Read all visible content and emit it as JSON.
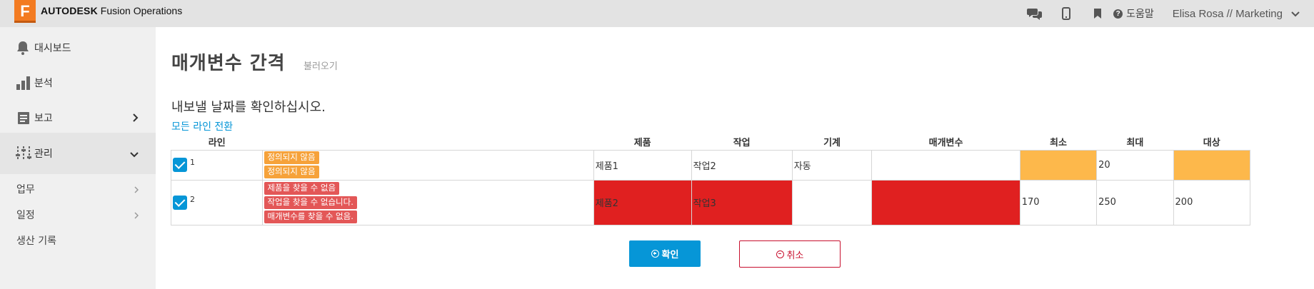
{
  "app": {
    "logo_letter": "F",
    "brand_bold": "AUTODESK",
    "brand_rest": "Fusion Operations"
  },
  "topbar": {
    "icons": [
      "chat-icon",
      "mobile-icon",
      "bookmark-icon"
    ],
    "help_label": "도움말",
    "help_icon_glyph": "?",
    "user_label": "Elisa Rosa // Marketing"
  },
  "sidebar": {
    "items": [
      {
        "label": "대시보드",
        "icon": "bell-icon"
      },
      {
        "label": "분석",
        "icon": "bar-chart-icon"
      },
      {
        "label": "보고",
        "icon": "report-icon"
      },
      {
        "label": "관리",
        "icon": "sliders-icon"
      }
    ],
    "subitems": [
      {
        "label": "업무"
      },
      {
        "label": "일정"
      },
      {
        "label": "생산 기록"
      }
    ]
  },
  "main": {
    "title": "매개변수 간격",
    "subtitle": "불러오기",
    "instruction": "내보낼 날짜를 확인하십시오.",
    "toggle_all": "모든 라인 전환"
  },
  "table": {
    "headers": [
      "라인",
      "",
      "제품",
      "작업",
      "기계",
      "매개변수",
      "최소",
      "최대",
      "대상"
    ],
    "rows": [
      {
        "line": "1",
        "checked": true,
        "messages": [
          {
            "text": "정의되지 않음",
            "level": "warning"
          },
          {
            "text": "정의되지 않음",
            "level": "warning"
          }
        ],
        "product": "제품1",
        "task": "작업2",
        "machine": "자동",
        "parameter": "",
        "min": "",
        "max": "20",
        "target": ""
      },
      {
        "line": "2",
        "checked": true,
        "messages": [
          {
            "text": "제품을 찾을 수 없음",
            "level": "error"
          },
          {
            "text": "작업을 찾을 수 없습니다.",
            "level": "error"
          },
          {
            "text": "매개변수를 찾을 수 없음.",
            "level": "error"
          }
        ],
        "product": "제품2",
        "task": "작업3",
        "machine": "",
        "parameter": "",
        "min": "170",
        "max": "250",
        "target": "200"
      }
    ]
  },
  "buttons": {
    "confirm": "확인",
    "cancel": "취소"
  },
  "colors": {
    "accent": "#0696d7",
    "warning": "#fdb84b",
    "error": "#e02020",
    "cancel": "#c8102e",
    "brand": "#f37b21"
  }
}
